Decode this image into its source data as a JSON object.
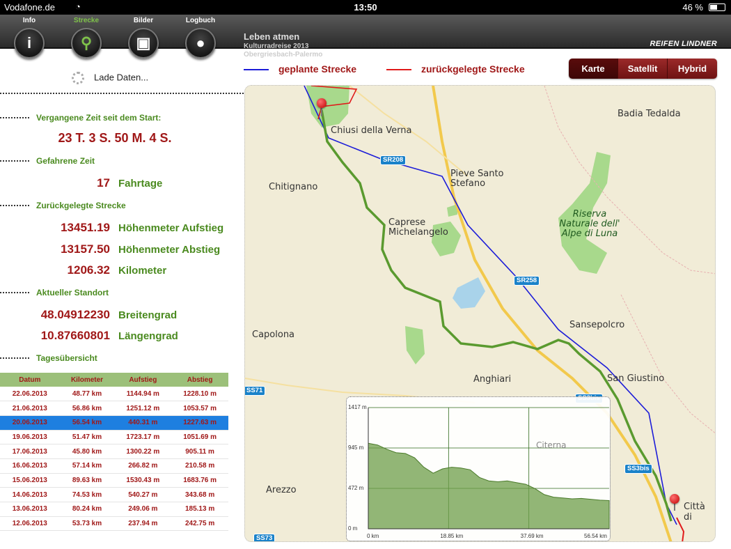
{
  "status": {
    "carrier": "Vodafone.de",
    "time": "13:50",
    "battery": "46 %"
  },
  "nav": [
    {
      "label": "Info",
      "icon": "info-icon",
      "glyph": "i"
    },
    {
      "label": "Strecke",
      "icon": "search-icon",
      "glyph": "⚲"
    },
    {
      "label": "Bilder",
      "icon": "pictures-icon",
      "glyph": "▣"
    },
    {
      "label": "Logbuch",
      "icon": "user-icon",
      "glyph": "●"
    }
  ],
  "trip": {
    "title": "Leben atmen",
    "subtitle": "Kulturradreise 2013",
    "route": "Obergriesbach-Palermo"
  },
  "brand": "REIFEN LINDNER",
  "loading": "Lade Daten...",
  "legend": {
    "planned": "geplante Strecke",
    "traveled": "zurückgelegte Strecke",
    "planned_color": "#1c1cd8",
    "traveled_color": "#e01a1a"
  },
  "map_types": [
    "Karte",
    "Satellit",
    "Hybrid"
  ],
  "map_type_selected": "Karte",
  "stats": {
    "elapsed_label": "Vergangene Zeit seit dem Start:",
    "elapsed_value": "23 T. 3 S. 50 M. 4 S.",
    "ride_label": "Gefahrene Zeit",
    "ride_days": "17",
    "ride_unit": "Fahrtage",
    "distance_label": "Zurückgelegte Strecke",
    "ascent_value": "13451.19",
    "ascent_unit": "Höhenmeter Aufstieg",
    "descent_value": "13157.50",
    "descent_unit": "Höhenmeter Abstieg",
    "km_value": "1206.32",
    "km_unit": "Kilometer",
    "location_label": "Aktueller Standort",
    "lat_value": "48.04912230",
    "lat_unit": "Breitengrad",
    "lon_value": "10.87660801",
    "lon_unit": "Längengrad",
    "daily_label": "Tagesübersicht"
  },
  "table": {
    "headers": [
      "Datum",
      "Kilometer",
      "Aufstieg",
      "Abstieg"
    ],
    "selected_index": 2,
    "rows": [
      [
        "22.06.2013",
        "48.77 km",
        "1144.94 m",
        "1228.10 m"
      ],
      [
        "21.06.2013",
        "56.86 km",
        "1251.12 m",
        "1053.57 m"
      ],
      [
        "20.06.2013",
        "56.54 km",
        "440.31 m",
        "1227.63 m"
      ],
      [
        "19.06.2013",
        "51.47 km",
        "1723.17 m",
        "1051.69 m"
      ],
      [
        "17.06.2013",
        "45.80 km",
        "1300.22 m",
        "905.11 m"
      ],
      [
        "16.06.2013",
        "57.14 km",
        "266.82 m",
        "210.58 m"
      ],
      [
        "15.06.2013",
        "89.63 km",
        "1530.43 m",
        "1683.76 m"
      ],
      [
        "14.06.2013",
        "74.53 km",
        "540.27 m",
        "343.68 m"
      ],
      [
        "13.06.2013",
        "80.24 km",
        "249.06 m",
        "185.13 m"
      ],
      [
        "12.06.2013",
        "53.73 km",
        "237.94 m",
        "242.75 m"
      ]
    ]
  },
  "map": {
    "places": [
      "Badia Tedalda",
      "Chiusi della Verna",
      "Pieve Santo Stefano",
      "Chitignano",
      "Caprese Michelangelo",
      "Riserva Naturale dell' Alpe di Luna",
      "Sansepolcro",
      "Capolona",
      "Anghiari",
      "San Giustino",
      "Arezzo",
      "Città di",
      "Citerna"
    ],
    "roads": [
      "SR208",
      "SR258",
      "SS3bis",
      "SS3bis",
      "SS71",
      "SS73"
    ]
  },
  "elevation": {
    "y_ticks": [
      "1417 m",
      "945 m",
      "472 m",
      "0 m"
    ],
    "x_ticks": [
      "0 km",
      "18.85 km",
      "37.69 km",
      "56.54 km"
    ],
    "profile_m": [
      1000,
      980,
      930,
      890,
      880,
      830,
      720,
      650,
      700,
      720,
      710,
      690,
      600,
      560,
      550,
      560,
      540,
      520,
      470,
      400,
      370,
      360,
      350,
      355,
      345,
      335,
      330
    ]
  }
}
